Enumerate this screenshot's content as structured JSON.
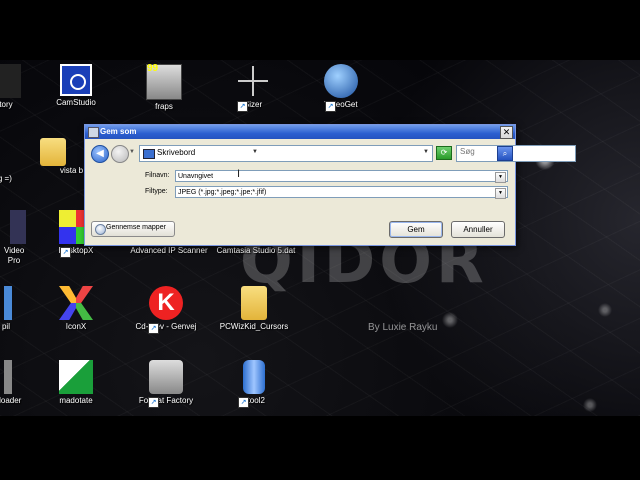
{
  "desktop": {
    "wallpaper_logo": "QIDOR",
    "wallpaper_credit": "By Luxie Rayku",
    "icons": [
      {
        "label": "ctory"
      },
      {
        "label": "CamStudio"
      },
      {
        "label": "fraps"
      },
      {
        "label": "Sizer"
      },
      {
        "label": "VideoGet"
      },
      {
        "label": "ig =)"
      },
      {
        "label": "vista b"
      },
      {
        "label": "Video Pro"
      },
      {
        "label": "DesktopX"
      },
      {
        "label": "Advanced IP Scanner"
      },
      {
        "label": "Camtasia Studio 5.dat"
      },
      {
        "label": "pil"
      },
      {
        "label": "IconX"
      },
      {
        "label": "Cd-drev - Genvej"
      },
      {
        "label": "PCWizKid_Cursors"
      },
      {
        "label": "nloader"
      },
      {
        "label": "madotate"
      },
      {
        "label": "Format Factory"
      },
      {
        "label": "utool2"
      }
    ],
    "fraps_badge": "99"
  },
  "dialog": {
    "title": "Gem som",
    "close_glyph": "✕",
    "location": "Skrivebord",
    "search_placeholder": "Søg",
    "filename_label": "Filnavn:",
    "filename_value": "Unavngivet",
    "filetype_label": "Filtype:",
    "filetype_value": "JPEG (*.jpg;*.jpeg;*.jpe;*.jfif)",
    "browse_label": "Gennemse mapper",
    "save_label": "Gem",
    "cancel_label": "Annuller"
  }
}
